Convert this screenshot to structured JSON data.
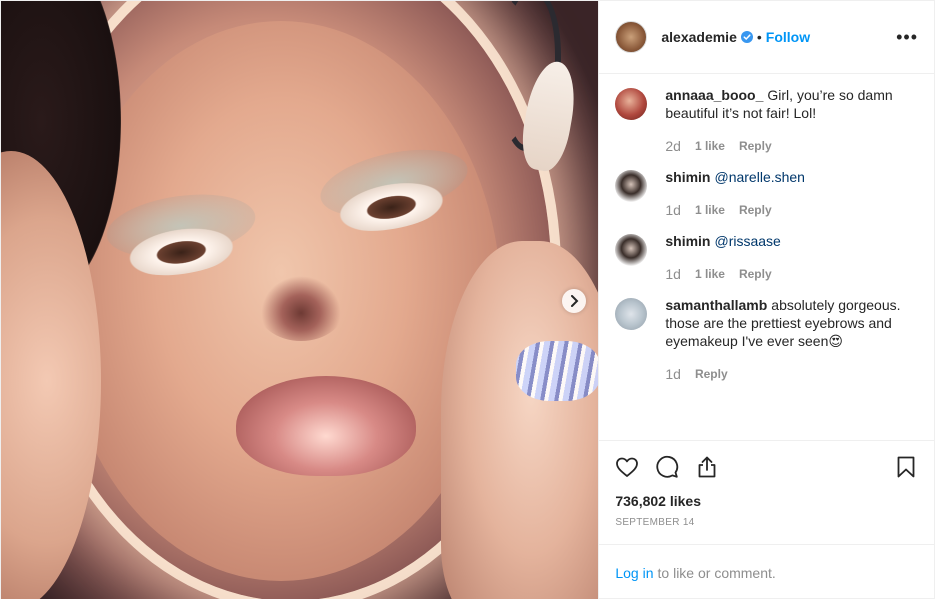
{
  "header": {
    "username": "alexademie",
    "dot": "•",
    "follow_label": "Follow",
    "more_label": "•••"
  },
  "comments": [
    {
      "username": "annaaa_booo_",
      "text": "Girl, you’re so damn beautiful it’s not fair! Lol!",
      "mention": "",
      "time": "2d",
      "likes": "1 like",
      "reply": "Reply"
    },
    {
      "username": "shimin",
      "text": "",
      "mention": "@narelle.shen",
      "time": "1d",
      "likes": "1 like",
      "reply": "Reply"
    },
    {
      "username": "shimin",
      "text": "",
      "mention": "@rissaase",
      "time": "1d",
      "likes": "1 like",
      "reply": "Reply"
    },
    {
      "username": "samanthallamb",
      "text": "absolutely gorgeous. those are the prettiest eyebrows and eyemakeup I've ever seen😍",
      "mention": "",
      "time": "1d",
      "likes": "",
      "reply": "Reply"
    }
  ],
  "likes_label": "736,802 likes",
  "date_label": "SEPTEMBER 14",
  "login": {
    "link": "Log in",
    "text": "to like or comment."
  },
  "colors": {
    "accent": "#0095f6",
    "muted": "#8e8e8e",
    "mention": "#00376b"
  },
  "icons": [
    "verified-badge-icon",
    "more-options-icon",
    "heart-icon",
    "comment-icon",
    "share-icon",
    "bookmark-icon",
    "chevron-right-icon"
  ]
}
